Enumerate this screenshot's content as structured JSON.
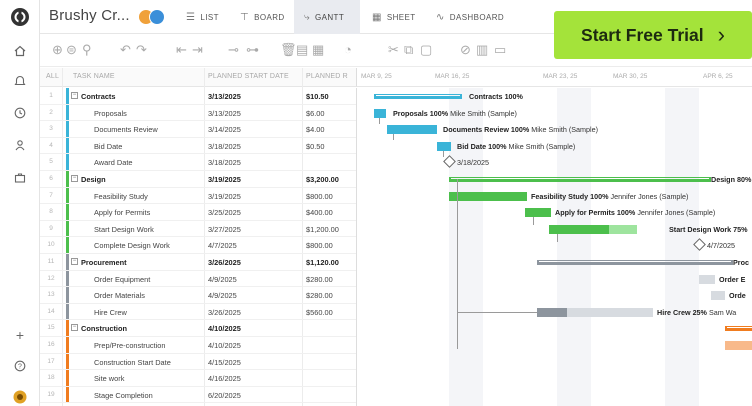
{
  "project": {
    "title": "Brushy Cr..."
  },
  "avatars": [
    {
      "initials": "",
      "color": "#f0a13a"
    },
    {
      "initials": "",
      "color": "#3b8fd9"
    }
  ],
  "views": [
    {
      "label": "LIST",
      "icon": "list-icon",
      "active": false
    },
    {
      "label": "BOARD",
      "icon": "board-icon",
      "active": false
    },
    {
      "label": "GANTT",
      "icon": "gantt-icon",
      "active": true
    },
    {
      "label": "SHEET",
      "icon": "sheet-icon",
      "active": false
    },
    {
      "label": "DASHBOARD",
      "icon": "dashboard-icon",
      "active": false
    }
  ],
  "cta": {
    "label": "Start Free Trial",
    "arrow": "›",
    "color": "#a4e33a"
  },
  "grid_headers": {
    "all": "ALL",
    "task_name": "TASK NAME",
    "planned_start": "PLANNED START DATE",
    "planned_cost": "PLANNED R"
  },
  "rows": [
    {
      "num": "1",
      "name": "Contracts",
      "start": "3/13/2025",
      "cost": "$10.50",
      "parent": true,
      "color": "#3ab4d8"
    },
    {
      "num": "2",
      "name": "Proposals",
      "start": "3/13/2025",
      "cost": "$6.00",
      "parent": false,
      "color": "#3ab4d8"
    },
    {
      "num": "3",
      "name": "Documents Review",
      "start": "3/14/2025",
      "cost": "$4.00",
      "parent": false,
      "color": "#3ab4d8"
    },
    {
      "num": "4",
      "name": "Bid Date",
      "start": "3/18/2025",
      "cost": "$0.50",
      "parent": false,
      "color": "#3ab4d8"
    },
    {
      "num": "5",
      "name": "Award Date",
      "start": "3/18/2025",
      "cost": "",
      "parent": false,
      "color": "#3ab4d8"
    },
    {
      "num": "6",
      "name": "Design",
      "start": "3/19/2025",
      "cost": "$3,200.00",
      "parent": true,
      "color": "#4cbf4c"
    },
    {
      "num": "7",
      "name": "Feasibility Study",
      "start": "3/19/2025",
      "cost": "$800.00",
      "parent": false,
      "color": "#4cbf4c"
    },
    {
      "num": "8",
      "name": "Apply for Permits",
      "start": "3/25/2025",
      "cost": "$400.00",
      "parent": false,
      "color": "#4cbf4c"
    },
    {
      "num": "9",
      "name": "Start Design Work",
      "start": "3/27/2025",
      "cost": "$1,200.00",
      "parent": false,
      "color": "#4cbf4c"
    },
    {
      "num": "10",
      "name": "Complete Design Work",
      "start": "4/7/2025",
      "cost": "$800.00",
      "parent": false,
      "color": "#4cbf4c"
    },
    {
      "num": "11",
      "name": "Procurement",
      "start": "3/26/2025",
      "cost": "$1,120.00",
      "parent": true,
      "color": "#8d959e"
    },
    {
      "num": "12",
      "name": "Order Equipment",
      "start": "4/9/2025",
      "cost": "$280.00",
      "parent": false,
      "color": "#8d959e"
    },
    {
      "num": "13",
      "name": "Order Materials",
      "start": "4/9/2025",
      "cost": "$280.00",
      "parent": false,
      "color": "#8d959e"
    },
    {
      "num": "14",
      "name": "Hire Crew",
      "start": "3/26/2025",
      "cost": "$560.00",
      "parent": false,
      "color": "#8d959e"
    },
    {
      "num": "15",
      "name": "Construction",
      "start": "4/10/2025",
      "cost": "",
      "parent": true,
      "color": "#f07c1f"
    },
    {
      "num": "16",
      "name": "Prep/Pre-construction",
      "start": "4/10/2025",
      "cost": "",
      "parent": false,
      "color": "#f07c1f"
    },
    {
      "num": "17",
      "name": "Construction Start Date",
      "start": "4/15/2025",
      "cost": "",
      "parent": false,
      "color": "#f07c1f"
    },
    {
      "num": "18",
      "name": "Site work",
      "start": "4/16/2025",
      "cost": "",
      "parent": false,
      "color": "#f07c1f"
    },
    {
      "num": "19",
      "name": "Stage Completion",
      "start": "6/20/2025",
      "cost": "",
      "parent": false,
      "color": "#f07c1f"
    }
  ],
  "timeline_dates": [
    "MAR 9, 25",
    "MAR 16, 25",
    "MAR 23, 25",
    "MAR 30, 25",
    "APR 6, 25"
  ],
  "gantt_labels": [
    {
      "task": "Contracts",
      "pct": "100%",
      "who": ""
    },
    {
      "task": "Proposals",
      "pct": "100%",
      "who": "Mike Smith (Sample)"
    },
    {
      "task": "Documents Review",
      "pct": "100%",
      "who": "Mike Smith (Sample)"
    },
    {
      "task": "Bid Date",
      "pct": "100%",
      "who": "Mike Smith (Sample)"
    },
    {
      "task": "",
      "pct": "",
      "who": "3/18/2025"
    },
    {
      "task": "Design",
      "pct": "80%",
      "who": ""
    },
    {
      "task": "Feasibility Study",
      "pct": "100%",
      "who": "Jennifer Jones (Sample)"
    },
    {
      "task": "Apply for Permits",
      "pct": "100%",
      "who": "Jennifer Jones (Sample)"
    },
    {
      "task": "Start Design Work",
      "pct": "75%",
      "who": ""
    },
    {
      "task": "",
      "pct": "",
      "who": "4/7/2025"
    },
    {
      "task": "Proc",
      "pct": "",
      "who": ""
    },
    {
      "task": "Order E",
      "pct": "",
      "who": ""
    },
    {
      "task": "Orde",
      "pct": "",
      "who": ""
    },
    {
      "task": "Hire Crew",
      "pct": "25%",
      "who": "Sam Wa"
    }
  ]
}
